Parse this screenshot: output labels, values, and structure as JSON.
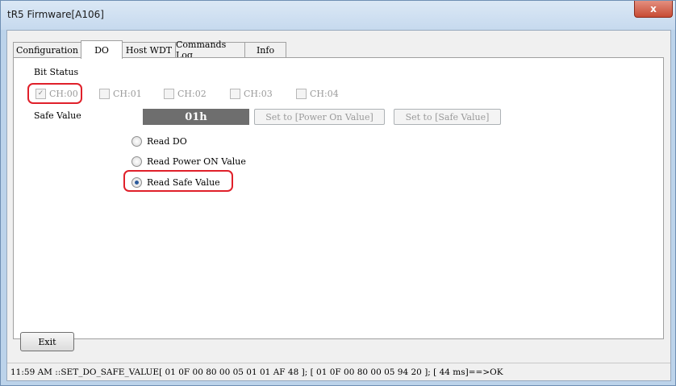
{
  "window": {
    "title": "tR5 Firmware[A106]",
    "close_glyph": "x"
  },
  "tabs": [
    {
      "label": "Configuration"
    },
    {
      "label": "DO"
    },
    {
      "label": "Host WDT"
    },
    {
      "label": "Commands Log"
    },
    {
      "label": "Info"
    }
  ],
  "do_panel": {
    "bit_status_label": "Bit Status",
    "channels": [
      {
        "label": "CH:00",
        "checked": true
      },
      {
        "label": "CH:01",
        "checked": false
      },
      {
        "label": "CH:02",
        "checked": false
      },
      {
        "label": "CH:03",
        "checked": false
      },
      {
        "label": "CH:04",
        "checked": false
      }
    ],
    "safe_value_label": "Safe Value",
    "value_display": "01h",
    "set_power_on_button": "Set to [Power On Value]",
    "set_safe_button": "Set to [Safe Value]",
    "read_options": [
      {
        "label": "Read DO",
        "selected": false
      },
      {
        "label": "Read Power ON Value",
        "selected": false
      },
      {
        "label": "Read Safe Value",
        "selected": true
      }
    ]
  },
  "exit_button": "Exit",
  "status_text": "11:59 AM ::SET_DO_SAFE_VALUE[ 01 0F 00 80 00 05 01 01 AF 48 ]; [ 01 0F 00 80 00 05 94 20  ]; [ 44 ms]==>OK",
  "colors": {
    "highlight": "#e0202a",
    "value_box_bg": "#6e6e6e",
    "title_bar": "#c6d9ee"
  }
}
